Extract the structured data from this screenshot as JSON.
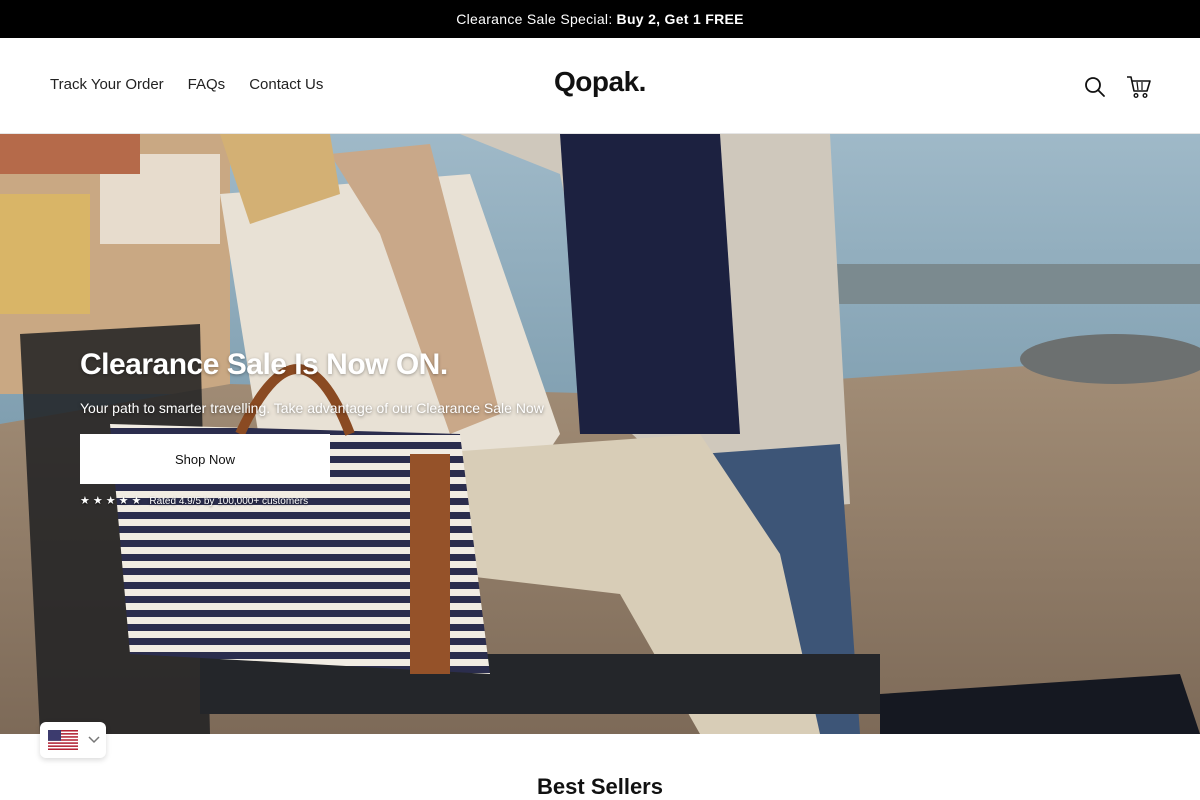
{
  "announcement": {
    "text": "Clearance Sale Special:",
    "highlight": "Buy 2, Get 1 FREE"
  },
  "header": {
    "nav": [
      {
        "label": "Track Your Order"
      },
      {
        "label": "FAQs"
      },
      {
        "label": "Contact Us"
      }
    ],
    "logo": "Qopak.",
    "icons": [
      "search-icon",
      "cart-icon"
    ]
  },
  "hero": {
    "title": "Clearance Sale Is Now ON.",
    "subtitle": "Your path to smarter travelling. Take advantage of our Clearance Sale Now",
    "cta_label": "Shop Now",
    "rating_stars": 5,
    "rating_text": "Rated 4.9/5 by 100,000+ customers"
  },
  "locale": {
    "flag": "us-flag-icon",
    "dropdown_icon": "chevron-down-icon"
  },
  "sections": {
    "best_sellers_title": "Best Sellers"
  },
  "colors": {
    "announcement_bg": "#000000",
    "button_bg": "#ffffff",
    "text_dark": "#111111"
  }
}
